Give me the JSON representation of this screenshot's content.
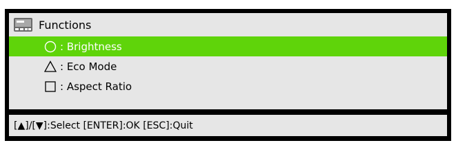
{
  "header": {
    "title": "Functions",
    "icon": "projector-remote-icon"
  },
  "menu": {
    "items": [
      {
        "symbol": "circle",
        "label": ": Brightness",
        "selected": true
      },
      {
        "symbol": "triangle",
        "label": ": Eco Mode",
        "selected": false
      },
      {
        "symbol": "square",
        "label": ": Aspect Ratio",
        "selected": false
      }
    ]
  },
  "status": {
    "text": "[▲]/[▼]:Select [ENTER]:OK [ESC]:Quit"
  },
  "colors": {
    "frame": "#000000",
    "panel": "#e6e6e6",
    "selected_row": "#5fd40a",
    "selected_text": "#ffffff"
  }
}
